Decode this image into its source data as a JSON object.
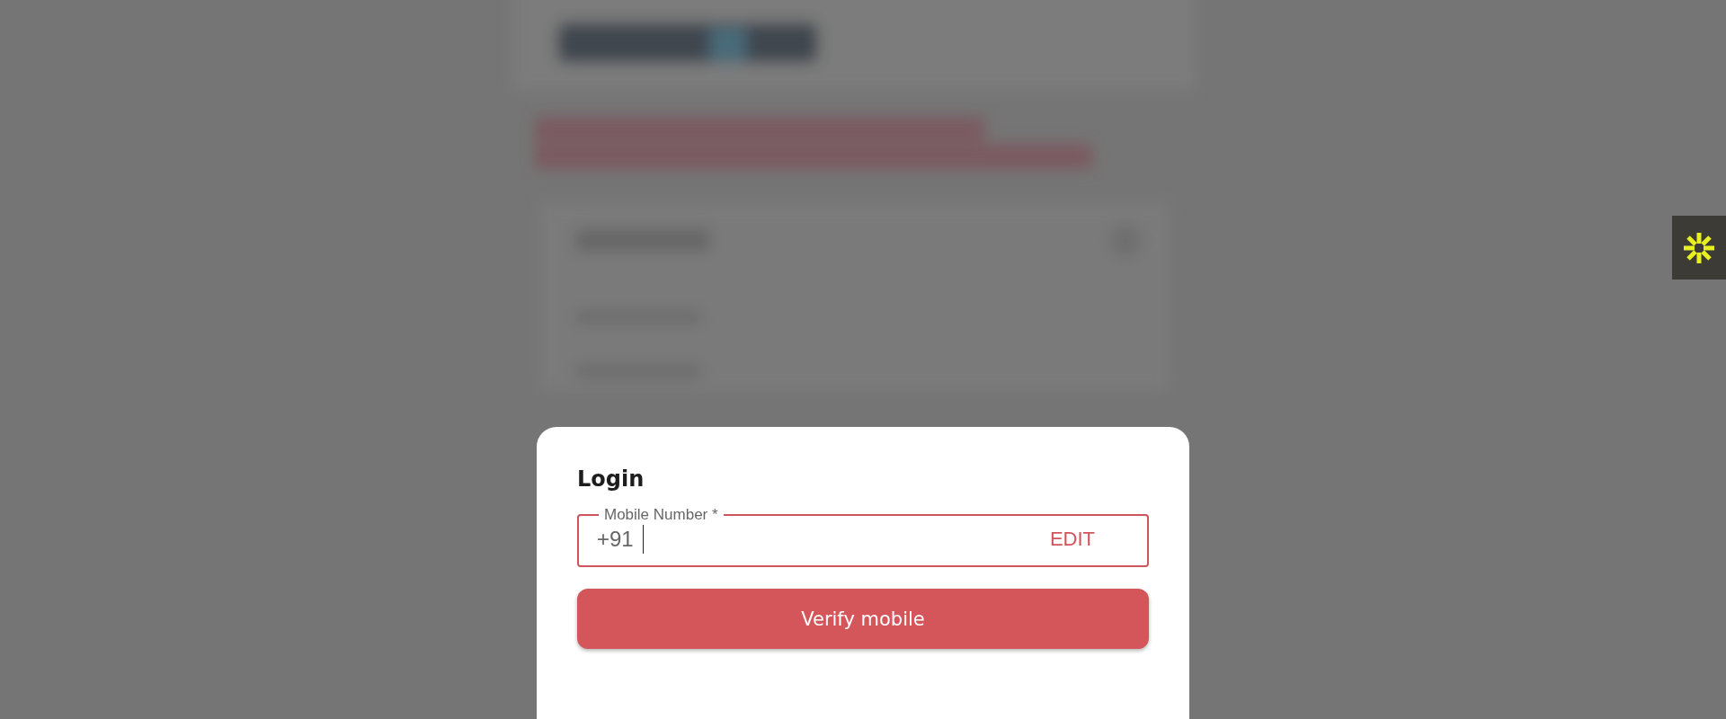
{
  "dialog": {
    "title": "Login",
    "mobile_field": {
      "label": "Mobile Number *",
      "prefix": "+91",
      "focused": true,
      "action": "EDIT"
    },
    "button": "Verify mobile"
  }
}
